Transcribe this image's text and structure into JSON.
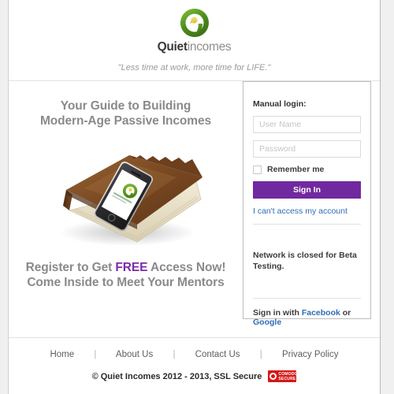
{
  "header": {
    "logo_icon": "quiet-incomes-q-logo",
    "logo_colors": {
      "ring_dark": "#4e8a1f",
      "ring_light": "#7cba2d",
      "dot": "#e8d24a"
    },
    "wordmark_bold": "Quiet",
    "wordmark_light": "incomes",
    "tagline": "\"Less time at work, more time for LIFE.\""
  },
  "main": {
    "headline_line1": "Your Guide to Building",
    "headline_line2": "Modern-Age Passive Incomes",
    "hero_image": "leather-book-with-smartphone",
    "subhead_line1_pre": "Register to Get ",
    "subhead_line1_highlight": "FREE",
    "subhead_line1_post": " Access Now!",
    "subhead_line2": "Come Inside to Meet Your Mentors",
    "accent_color": "#7b2ca8"
  },
  "login": {
    "manual_label": "Manual login:",
    "username_value": "",
    "username_placeholder": "User Name",
    "password_value": "",
    "password_placeholder": "Password",
    "remember_label": "Remember me",
    "remember_checked": false,
    "signin_label": "Sign In",
    "signin_color": "#71299f",
    "cant_access_label": "I can't access my account",
    "beta_note": "Network is closed for Beta Testing.",
    "social_prefix": "Sign in with ",
    "social_facebook": "Facebook",
    "social_joiner": " or ",
    "social_google": "Google",
    "link_color": "#2e6db4"
  },
  "footer": {
    "nav": [
      {
        "label": "Home"
      },
      {
        "label": "About Us"
      },
      {
        "label": "Contact Us"
      },
      {
        "label": "Privacy Policy"
      }
    ],
    "separator": "|",
    "copyright": "© Quiet Incomes 2012 - 2013, SSL Secure",
    "badge": {
      "name": "comodo-secure-badge",
      "line1": "COMODO",
      "line2": "SECURE",
      "color": "#d41818"
    }
  }
}
